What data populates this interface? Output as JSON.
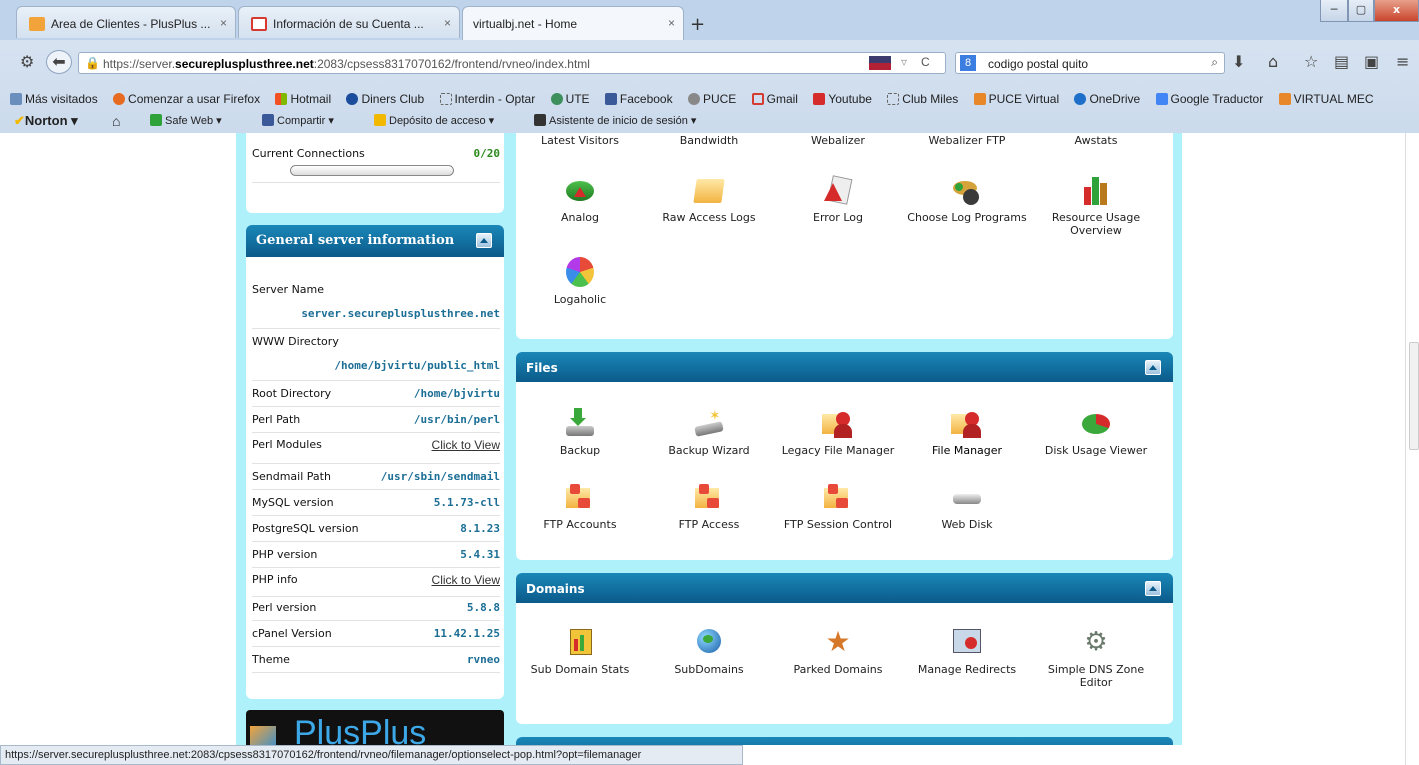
{
  "browser": {
    "tabs": [
      {
        "title": "Area de Clientes - PlusPlus ...",
        "close": "×"
      },
      {
        "title": "Información de su Cuenta ...",
        "close": "×"
      },
      {
        "title": "virtualbj.net - Home",
        "close": "×"
      }
    ],
    "new_tab": "+",
    "window_controls": [
      "─",
      "▢",
      "x"
    ],
    "url_prefix": "https://server.",
    "url_host": "secureplusplusthree.net",
    "url_rest": ":2083/cpsess8317070162/frontend/rvneo/index.html",
    "search_value": "codigo postal quito",
    "bookmarks": [
      "Más visitados",
      "Comenzar a usar Firefox",
      "Hotmail",
      "Diners Club",
      "Interdin - Optar",
      "UTE",
      "Facebook",
      "PUCE",
      "Gmail",
      "Youtube",
      "Club Miles",
      "PUCE Virtual",
      "OneDrive",
      "Google Traductor",
      "VIRTUAL MEC"
    ],
    "norton": {
      "brand": "Norton",
      "safe_web": "Safe Web",
      "share": "Compartir",
      "deposit": "Depósito de acceso",
      "assistant": "Asistente de inicio de sesión"
    },
    "status_url": "https://server.secureplusplusthree.net:2083/cpsess8317070162/frontend/rvneo/filemanager/optionselect-pop.html?opt=filemanager"
  },
  "stats": {
    "current_connections_label": "Current Connections",
    "current_connections_value": "0/20",
    "current_connections_fraction": 0
  },
  "server_info": {
    "title": "General server information",
    "rows": [
      {
        "label": "Server Name",
        "value": "server.secureplusplusthree.net"
      },
      {
        "label": "WWW Directory",
        "value": "/home/bjvirtu/public_html"
      },
      {
        "label": "Root Directory",
        "value": "/home/bjvirtu"
      },
      {
        "label": "Perl Path",
        "value": "/usr/bin/perl"
      },
      {
        "label": "Perl Modules",
        "value": "Click to View"
      },
      {
        "label": "Sendmail Path",
        "value": "/usr/sbin/sendmail"
      },
      {
        "label": "MySQL version",
        "value": "5.1.73-cll"
      },
      {
        "label": "PostgreSQL version",
        "value": "8.1.23"
      },
      {
        "label": "PHP version",
        "value": "5.4.31"
      },
      {
        "label": "PHP info",
        "value": "Click to View"
      },
      {
        "label": "Perl version",
        "value": "5.8.8"
      },
      {
        "label": "cPanel Version",
        "value": "11.42.1.25"
      },
      {
        "label": "Theme",
        "value": "rvneo"
      }
    ]
  },
  "logs": {
    "top_labels": [
      "Latest Visitors",
      "Bandwidth",
      "Webalizer",
      "Webalizer FTP",
      "Awstats"
    ],
    "items": [
      "Analog",
      "Raw Access Logs",
      "Error Log",
      "Choose Log Programs",
      "Resource Usage Overview",
      "Logaholic"
    ]
  },
  "files": {
    "title": "Files",
    "items": [
      "Backup",
      "Backup Wizard",
      "Legacy File Manager",
      "File Manager",
      "Disk Usage Viewer",
      "FTP Accounts",
      "FTP Access",
      "FTP Session Control",
      "Web Disk"
    ]
  },
  "domains": {
    "title": "Domains",
    "items": [
      "Sub Domain Stats",
      "SubDomains",
      "Parked Domains",
      "Manage Redirects",
      "Simple DNS Zone Editor"
    ]
  },
  "logo_text": "PlusPlus"
}
